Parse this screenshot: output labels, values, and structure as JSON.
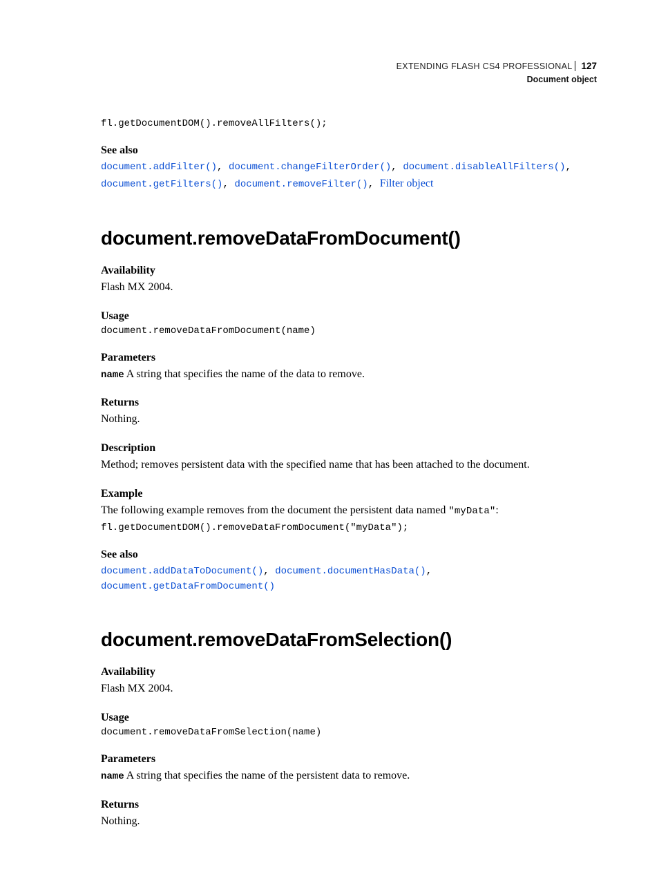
{
  "header": {
    "book": "EXTENDING FLASH CS4 PROFESSIONAL",
    "page_number": "127",
    "section": "Document object"
  },
  "top": {
    "code": "fl.getDocumentDOM().removeAllFilters();",
    "seealso_label": "See also",
    "links": {
      "l1": "document.addFilter()",
      "l2": "document.changeFilterOrder()",
      "l3": "document.disableAllFilters()",
      "l4": "document.getFilters()",
      "l5": "document.removeFilter()",
      "l6": "Filter object"
    }
  },
  "sec1": {
    "title": "document.removeDataFromDocument()",
    "availability_h": "Availability",
    "availability_t": "Flash MX 2004.",
    "usage_h": "Usage",
    "usage_code": "document.removeDataFromDocument(name)",
    "parameters_h": "Parameters",
    "param_name": "name",
    "param_desc": " A string that specifies the name of the data to remove.",
    "returns_h": "Returns",
    "returns_t": "Nothing.",
    "description_h": "Description",
    "description_t": "Method; removes persistent data with the specified name that has been attached to the document.",
    "example_h": "Example",
    "example_intro_a": "The following example removes from the document the persistent data named ",
    "example_intro_mono": "\"myData\"",
    "example_intro_b": ":",
    "example_code": "fl.getDocumentDOM().removeDataFromDocument(\"myData\");",
    "seealso_h": "See also",
    "seealso": {
      "l1": "document.addDataToDocument()",
      "l2": "document.documentHasData()",
      "l3": "document.getDataFromDocument()"
    }
  },
  "sec2": {
    "title": "document.removeDataFromSelection()",
    "availability_h": "Availability",
    "availability_t": "Flash MX 2004.",
    "usage_h": "Usage",
    "usage_code": "document.removeDataFromSelection(name)",
    "parameters_h": "Parameters",
    "param_name": "name",
    "param_desc": " A string that specifies the name of the persistent data to remove.",
    "returns_h": "Returns",
    "returns_t": "Nothing."
  }
}
